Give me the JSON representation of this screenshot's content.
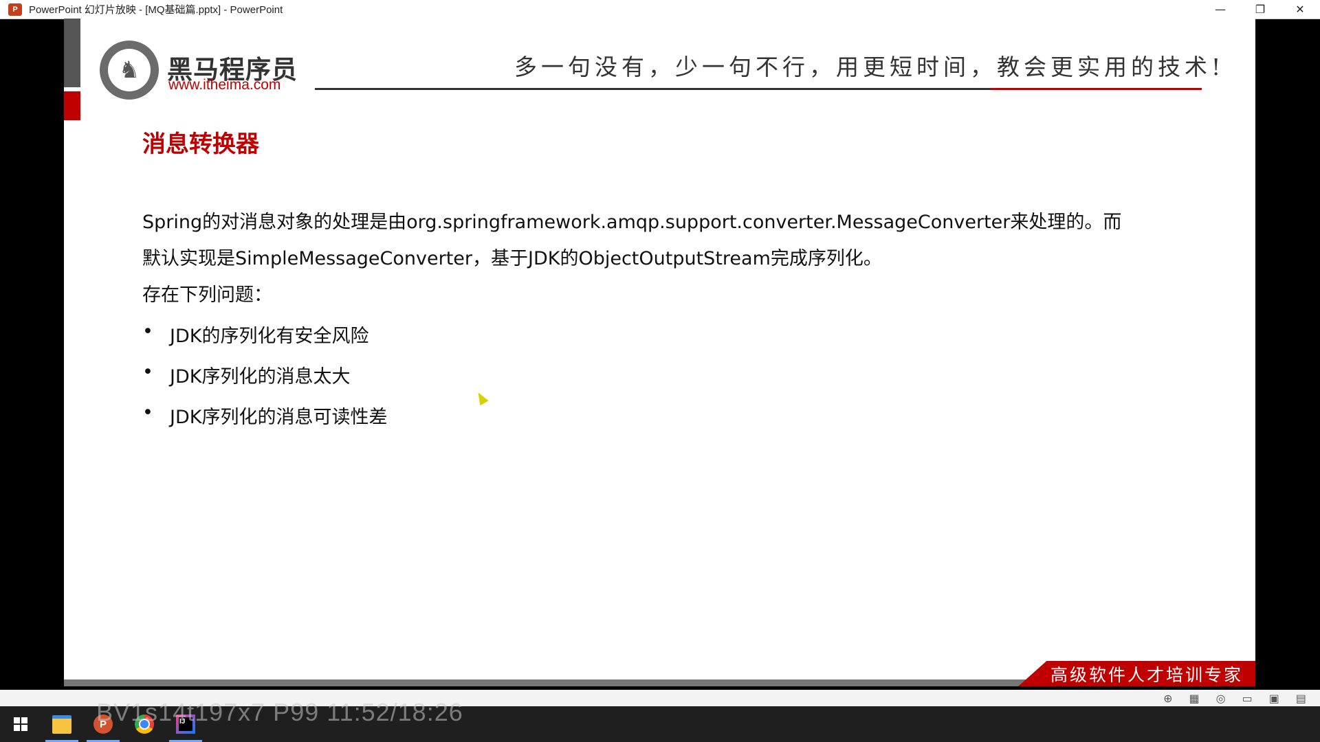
{
  "window": {
    "title": "PowerPoint 幻灯片放映 - [MQ基础篇.pptx] - PowerPoint",
    "app_icon": "P",
    "controls": {
      "minimize": "—",
      "restore": "❐",
      "close": "✕"
    }
  },
  "slide": {
    "logo": {
      "name": "黑马程序员",
      "url": "www.itheima.com",
      "icon": "horse-logo"
    },
    "slogan": "多一句没有，少一句不行，用更短时间，教会更实用的技术!",
    "title": "消息转换器",
    "paragraph_line1": "Spring的对消息对象的处理是由org.springframework.amqp.support.converter.MessageConverter来处理的。而",
    "paragraph_line2": "默认实现是SimpleMessageConverter，基于JDK的ObjectOutputStream完成序列化。",
    "question": "存在下列问题：",
    "bullets": [
      "JDK的序列化有安全风险",
      "JDK序列化的消息太大",
      "JDK序列化的消息可读性差"
    ],
    "bullet_glyph": "•",
    "footer_tag": "高级软件人才培训专家",
    "accent_color": "#c00000"
  },
  "taskbar": {
    "items": [
      "start-icon",
      "file-explorer-icon",
      "powerpoint-icon",
      "chrome-icon",
      "intellij-idea-icon"
    ],
    "ppt_label": "P",
    "idea_label": "IJ"
  },
  "overlay": {
    "watermark": "BV1s14t197x7 P99 11:52/18:26"
  }
}
